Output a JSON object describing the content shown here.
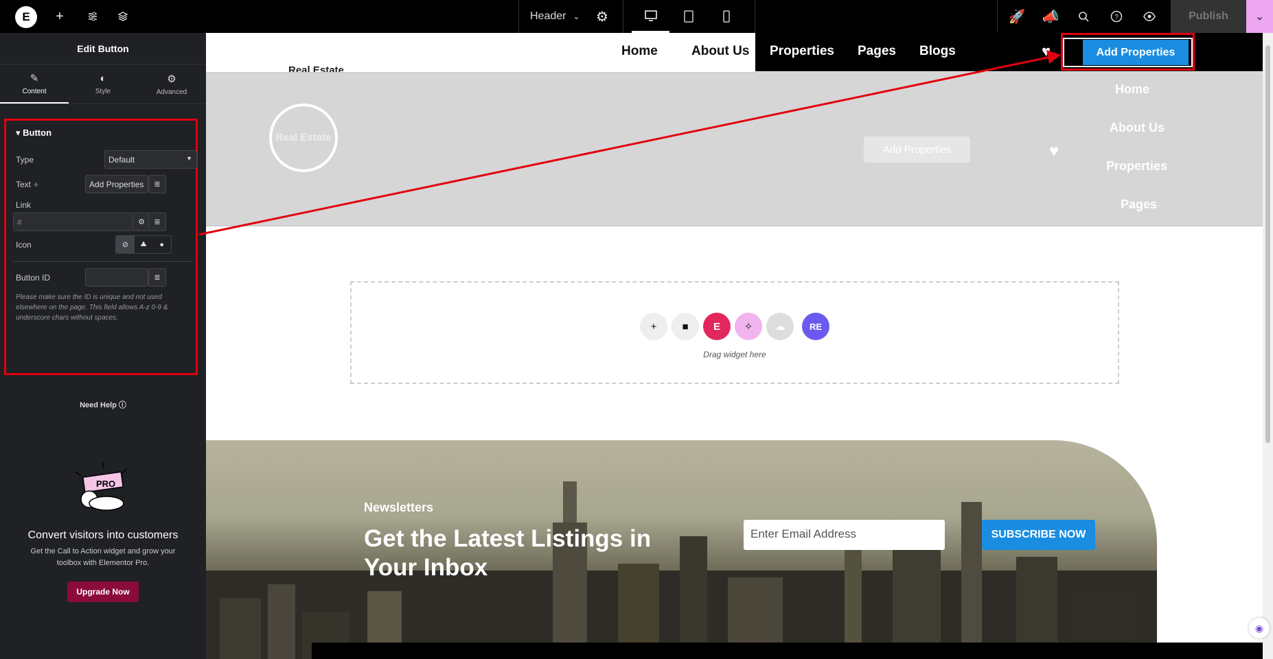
{
  "topbar": {
    "logo_glyph": "E",
    "header_label": "Header",
    "publish_label": "Publish"
  },
  "panel": {
    "title": "Edit Button",
    "tabs": [
      {
        "label": "Content",
        "icon": "pencil-icon"
      },
      {
        "label": "Style",
        "icon": "half-circle-icon"
      },
      {
        "label": "Advanced",
        "icon": "gear-icon"
      }
    ],
    "section_title": "Button",
    "type_label": "Type",
    "type_value": "Default",
    "text_label": "Text",
    "text_value": "Add Properties",
    "link_label": "Link",
    "link_placeholder": "#",
    "icon_label": "Icon",
    "button_id_label": "Button ID",
    "button_id_note": "Please make sure the ID is unique and not used elsewhere on the page. This field allows A-z  0-9 & underscore chars without spaces.",
    "need_help": "Need Help",
    "promo_title": "Convert visitors into customers",
    "promo_text": "Get the Call to Action widget and grow your toolbox with Elementor Pro.",
    "upgrade_label": "Upgrade Now"
  },
  "site": {
    "nav": [
      "Home",
      "About Us",
      "Properties",
      "Pages",
      "Blogs"
    ],
    "brand": "Real Estate",
    "add_button": "Add Properties",
    "logo_text": "Real Estate",
    "ghost_button": "Add Properties",
    "side_menu": [
      "Home",
      "About Us",
      "Properties",
      "Pages"
    ],
    "drop_text": "Drag widget here",
    "newsletter_label": "Newsletters",
    "newsletter_title": "Get the Latest Listings in Your Inbox",
    "email_placeholder": "Enter Email Address",
    "subscribe_label": "SUBSCRIBE NOW"
  },
  "colors": {
    "accent_blue": "#1a8de1",
    "highlight_red": "#e3000e",
    "panel_bg": "#1f2124"
  }
}
